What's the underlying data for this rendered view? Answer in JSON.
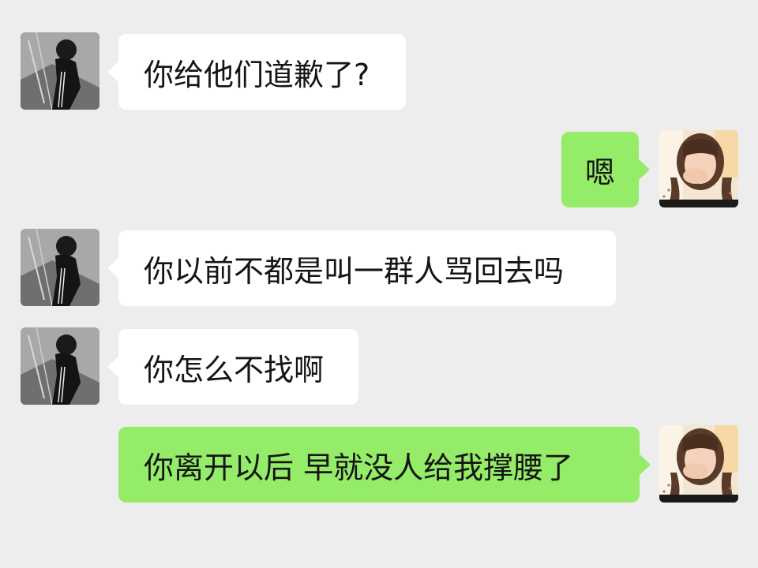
{
  "messages": [
    {
      "side": "left",
      "text": "你给他们道歉了?",
      "avatar": "boy-avatar"
    },
    {
      "side": "right",
      "text": "嗯",
      "avatar": "girl-avatar"
    },
    {
      "side": "left",
      "text": "你以前不都是叫一群人骂回去吗",
      "avatar": "boy-avatar"
    },
    {
      "side": "left",
      "text": "你怎么不找啊",
      "avatar": "boy-avatar"
    },
    {
      "side": "right",
      "text": "你离开以后 早就没人给我撑腰了",
      "avatar": "girl-avatar"
    }
  ],
  "colors": {
    "background": "#ededed",
    "incoming_bubble": "#ffffff",
    "outgoing_bubble": "#95ec69"
  }
}
